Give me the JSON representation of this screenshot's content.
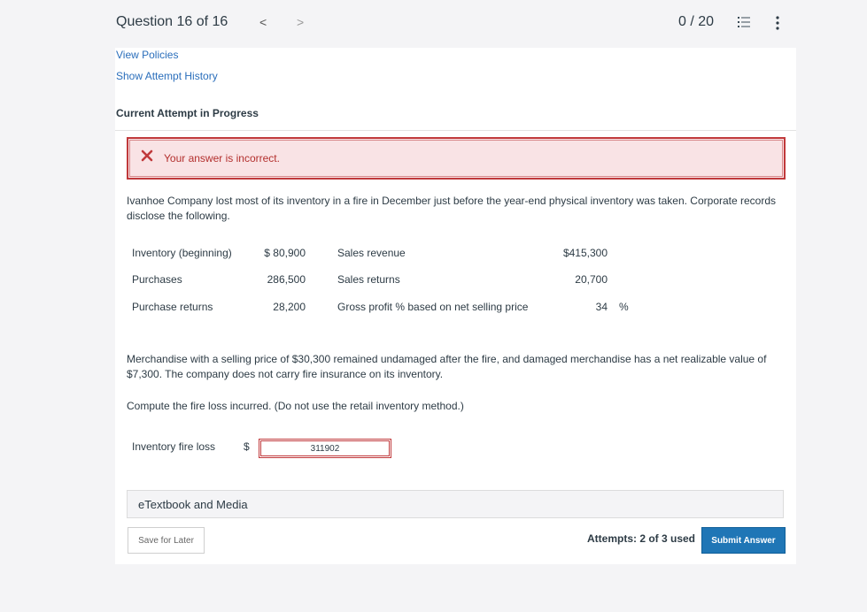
{
  "header": {
    "question_label": "Question 16 of 16",
    "prev_glyph": "<",
    "next_glyph": ">",
    "score": "0 / 20",
    "list_icon": "list-icon",
    "more_icon": "more-vertical-icon"
  },
  "links": {
    "view_policies": "View Policies",
    "show_attempt_history": "Show Attempt History"
  },
  "attempt_heading": "Current Attempt in Progress",
  "feedback": {
    "icon": "x-icon",
    "text": "Your answer is incorrect.",
    "color": "#c0393b"
  },
  "question": {
    "intro": "Ivanhoe Company lost most of its inventory in a fire in December just before the year-end physical inventory was taken. Corporate records disclose the following.",
    "table": {
      "left": [
        {
          "label": "Inventory (beginning)",
          "value": "$ 80,900"
        },
        {
          "label": "Purchases",
          "value": "286,500"
        },
        {
          "label": "Purchase returns",
          "value": "28,200"
        }
      ],
      "right": [
        {
          "label": "Sales revenue",
          "value": "$415,300",
          "unit": ""
        },
        {
          "label": "Sales returns",
          "value": "20,700",
          "unit": ""
        },
        {
          "label": "Gross profit % based on net selling price",
          "value": "34",
          "unit": "%"
        }
      ]
    },
    "details": "Merchandise with a selling price of $30,300 remained undamaged after the fire, and damaged merchandise has a net realizable value of $7,300. The company does not carry fire insurance on its inventory.",
    "instruction": "Compute the fire loss incurred. (Do not use the retail inventory method.)"
  },
  "answer": {
    "label": "Inventory fire loss",
    "currency": "$",
    "value": "311902"
  },
  "etextbook_label": "eTextbook and Media",
  "footer": {
    "save_label": "Save for Later",
    "attempts_text": "Attempts: 2 of 3 used",
    "submit_label": "Submit Answer",
    "submit_color": "#1f76b6"
  }
}
